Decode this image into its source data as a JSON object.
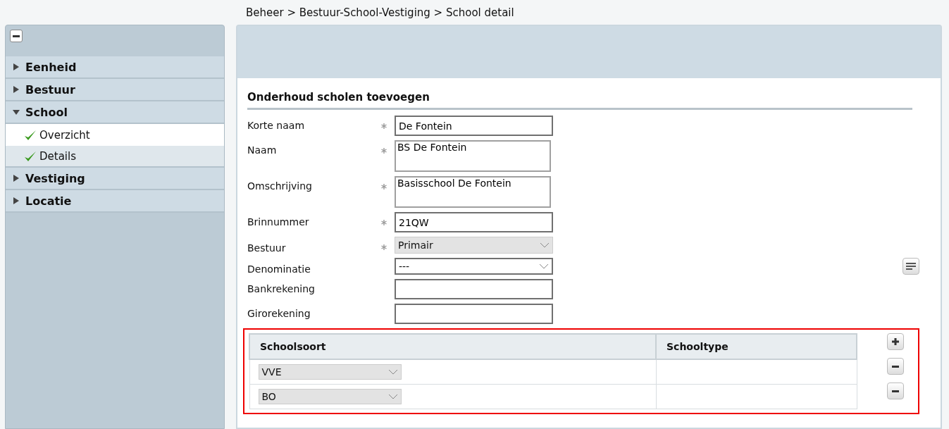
{
  "breadcrumb": "Beheer > Bestuur-School-Vestiging > School detail",
  "sidebar": {
    "items": [
      {
        "label": "Eenheid",
        "expanded": false
      },
      {
        "label": "Bestuur",
        "expanded": false
      },
      {
        "label": "School",
        "expanded": true,
        "children": [
          {
            "label": "Overzicht",
            "selected": true
          },
          {
            "label": "Details",
            "selected": false
          }
        ]
      },
      {
        "label": "Vestiging",
        "expanded": false
      },
      {
        "label": "Locatie",
        "expanded": false
      }
    ]
  },
  "form": {
    "title": "Onderhoud scholen toevoegen",
    "fields": [
      {
        "label": "Korte naam",
        "required": true,
        "kind": "text",
        "value": "De Fontein"
      },
      {
        "label": "Naam",
        "required": true,
        "kind": "textarea",
        "value": "BS De Fontein"
      },
      {
        "label": "Omschrijving",
        "required": true,
        "kind": "textarea",
        "value": "Basisschool De Fontein"
      },
      {
        "label": "Brinnummer",
        "required": true,
        "kind": "text",
        "value": "21QW"
      },
      {
        "label": "Bestuur",
        "required": true,
        "kind": "select",
        "value": "Primair",
        "disabled": true
      },
      {
        "label": "Denominatie",
        "required": false,
        "kind": "select",
        "value": "---",
        "disabled": false,
        "list_button": true
      },
      {
        "label": "Bankrekening",
        "required": false,
        "kind": "text"
      },
      {
        "label": "Girorekening",
        "required": false,
        "kind": "text"
      }
    ]
  },
  "table": {
    "columns": [
      "Schoolsoort",
      "Schooltype"
    ],
    "rows": [
      {
        "schoolsoort": "VVE"
      },
      {
        "schoolsoort": "BO"
      }
    ]
  }
}
